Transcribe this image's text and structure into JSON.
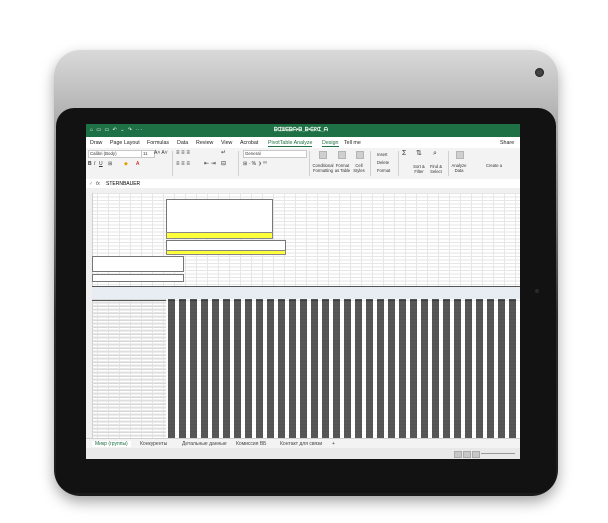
{
  "title_bar": {
    "quick_access": "⌂ ▭ ▭ ↶ ⌄ ↷ ···",
    "document_title": "ᗷᗭᗯᗴᗷᗩ•ᗷ_ᗷ•ᗴᖇᗭ_ᗩ"
  },
  "menu": {
    "items": [
      "Draw",
      "Page Layout",
      "Formulas",
      "Data",
      "Review",
      "View",
      "Acrobat",
      "PivotTable Analyze",
      "Design",
      "Tell me"
    ],
    "share": "Share"
  },
  "ribbon": {
    "font_name": "Calibri (Body)",
    "font_size": "11",
    "number_format": "General",
    "conditional_formatting": "Conditional Formatting",
    "format_as_table": "Format as Table",
    "cell_styles": "Cell Styles",
    "insert": "Insert",
    "delete": "Delete",
    "format": "Format",
    "sort_filter": "Sort & Filter",
    "find_select": "Find & Select",
    "analyze_data": "Analyze Data",
    "create_pdf": "Create a"
  },
  "formula_bar": {
    "fx": "fx",
    "content": "STERNBAUER"
  },
  "sheet_tabs": [
    "Микр (группы)",
    "Конкуренты",
    "Детальные данные",
    "Комиссия ВБ",
    "Контакт для связи"
  ],
  "add_sheet": "+",
  "colors": {
    "excel_green": "#1e7145",
    "highlight_yellow": "#ffff3c"
  }
}
